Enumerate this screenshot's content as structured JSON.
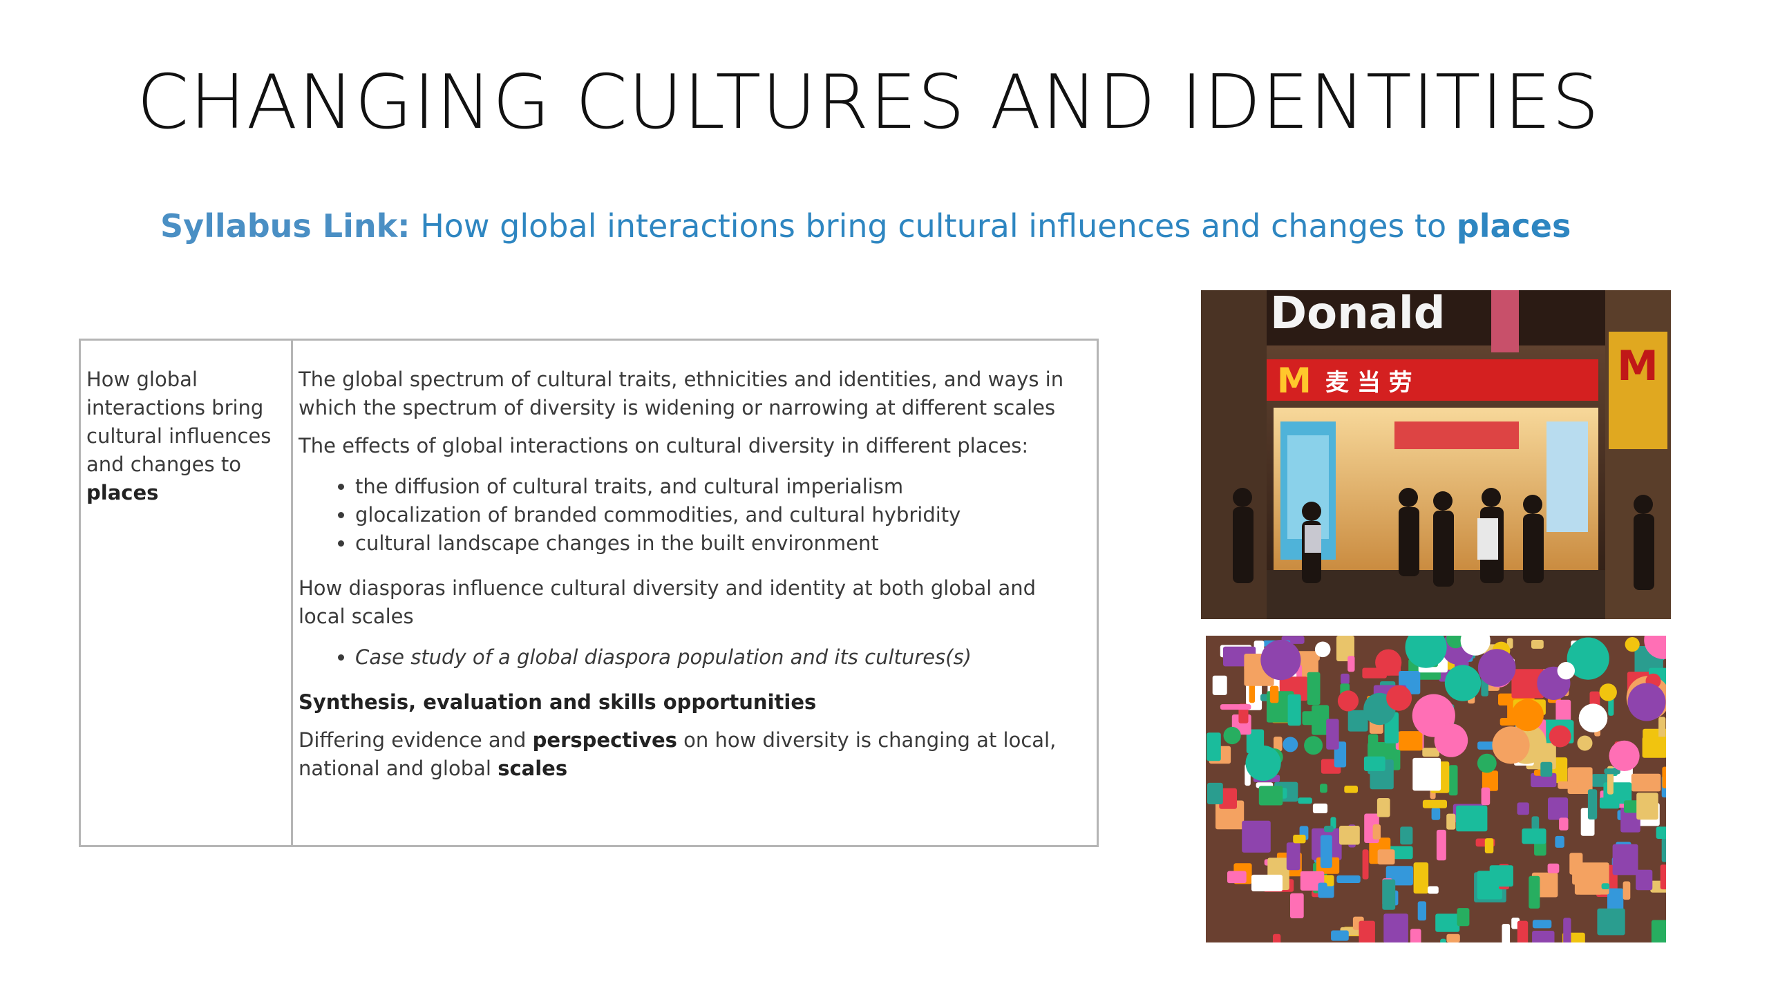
{
  "slide": {
    "title": "CHANGING CULTURES AND IDENTITIES",
    "syllabus": {
      "label": "Syllabus Link:",
      "text": " How global interactions bring cultural influences and changes to ",
      "bold_tail": "places"
    }
  },
  "table": {
    "left_cell": {
      "line1": "How global",
      "line2": "interactions bring",
      "line3": "cultural influences",
      "line4": "and changes to",
      "line5": "places"
    },
    "right_cell": {
      "p1": "The global spectrum of cultural traits, ethnicities and identities, and ways in which the spectrum of diversity is widening or narrowing at different scales",
      "p2": "The effects of global interactions on cultural diversity in different places:",
      "bullets1": [
        "the diffusion of cultural traits, and cultural imperialism",
        "glocalization of branded commodities, and cultural hybridity",
        "cultural landscape changes in the built environment"
      ],
      "p3": "How diasporas influence cultural diversity and identity at both global and local scales",
      "bullets2": [
        "Case study of a global diaspora population and its cultures(s)"
      ],
      "heading": "Synthesis, evaluation and skills opportunities",
      "p4_a": "Differing evidence and ",
      "p4_b": "perspectives",
      "p4_c": " on how diversity is changing at local, national and global ",
      "p4_d": "scales"
    }
  },
  "images": {
    "photo1": {
      "sign_text": "Donald",
      "m_logo": "M",
      "chinese_text": "麦 当 劳"
    }
  }
}
